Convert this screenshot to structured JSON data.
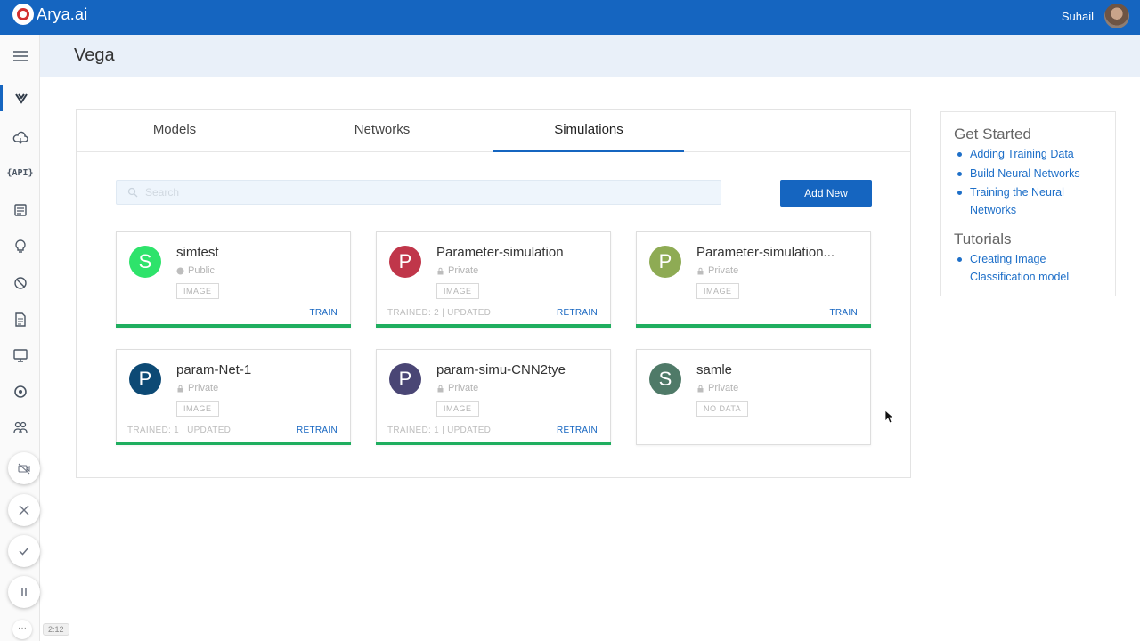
{
  "app": {
    "logo_text": "Arya.ai",
    "user_name": "Suhail"
  },
  "page": {
    "title": "Vega"
  },
  "tabs": [
    {
      "label": "Models",
      "active": false
    },
    {
      "label": "Networks",
      "active": false
    },
    {
      "label": "Simulations",
      "active": true
    }
  ],
  "search": {
    "placeholder": "Search",
    "value": ""
  },
  "add_button": "Add New",
  "cards": [
    {
      "initial": "S",
      "name": "simtest",
      "visibility": "Public",
      "tag": "IMAGE",
      "meta": "",
      "action": "TRAIN",
      "color": "#2ee36b",
      "has_bar": true
    },
    {
      "initial": "P",
      "name": "Parameter-simulation",
      "visibility": "Private",
      "tag": "IMAGE",
      "meta": "TRAINED: 2 | UPDATED",
      "action": "RETRAIN",
      "color": "#c0364a",
      "has_bar": true
    },
    {
      "initial": "P",
      "name": "Parameter-simulation...",
      "visibility": "Private",
      "tag": "IMAGE",
      "meta": "",
      "action": "TRAIN",
      "color": "#8eab54",
      "has_bar": true
    },
    {
      "initial": "P",
      "name": "param-Net-1",
      "visibility": "Private",
      "tag": "IMAGE",
      "meta": "TRAINED: 1 | UPDATED",
      "action": "RETRAIN",
      "color": "#0d4a75",
      "has_bar": true
    },
    {
      "initial": "P",
      "name": "param-simu-CNN2tye",
      "visibility": "Private",
      "tag": "IMAGE",
      "meta": "TRAINED: 1 | UPDATED",
      "action": "RETRAIN",
      "color": "#4a4675",
      "has_bar": true
    },
    {
      "initial": "S",
      "name": "samle",
      "visibility": "Private",
      "tag": "NO DATA",
      "meta": "",
      "action": "",
      "color": "#4f7a68",
      "has_bar": false
    }
  ],
  "get_started": {
    "title": "Get Started",
    "links": [
      "Adding Training Data",
      "Build Neural Networks",
      "Training the Neural Networks"
    ]
  },
  "tutorials": {
    "title": "Tutorials",
    "links": [
      "Creating Image Classification model"
    ]
  },
  "recorder": {
    "timer": "2:12"
  },
  "colors": {
    "primary": "#1565c0",
    "progress": "#1fae5f",
    "link": "#1e6fc8"
  }
}
